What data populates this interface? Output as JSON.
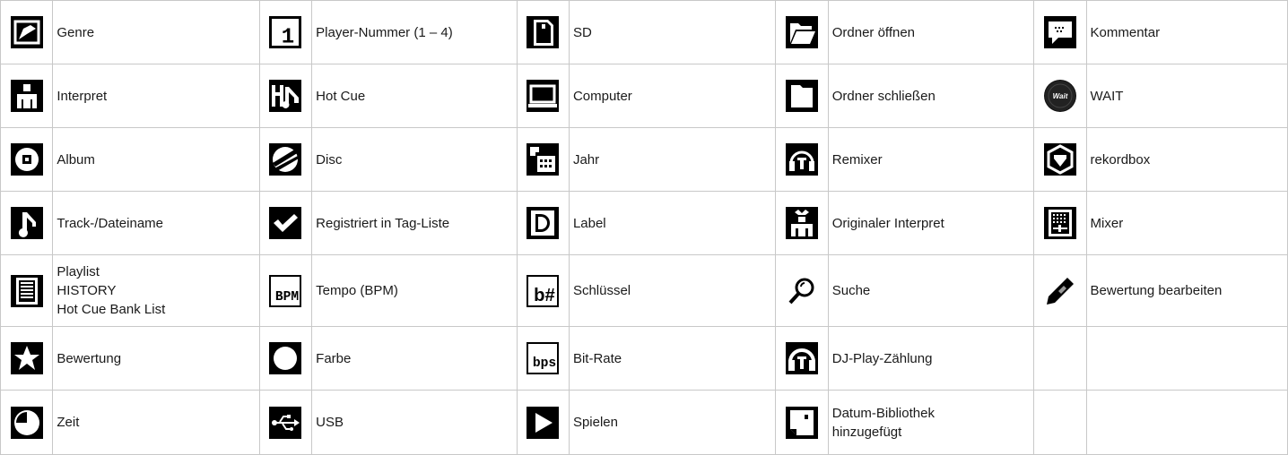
{
  "icon_rows": [
    [
      {
        "icon": "genre-icon",
        "label": "Genre"
      },
      {
        "icon": "player-number-icon",
        "label": "Player-Nummer (1 – 4)"
      },
      {
        "icon": "sd-card-icon",
        "label": "SD"
      },
      {
        "icon": "folder-open-icon",
        "label": "Ordner öffnen"
      },
      {
        "icon": "comment-icon",
        "label": "Kommentar"
      }
    ],
    [
      {
        "icon": "artist-icon",
        "label": "Interpret"
      },
      {
        "icon": "hot-cue-icon",
        "label": "Hot Cue"
      },
      {
        "icon": "computer-icon",
        "label": "Computer"
      },
      {
        "icon": "folder-closed-icon",
        "label": "Ordner schließen"
      },
      {
        "icon": "wait-icon",
        "label": "WAIT"
      }
    ],
    [
      {
        "icon": "album-icon",
        "label": "Album"
      },
      {
        "icon": "disc-icon",
        "label": "Disc"
      },
      {
        "icon": "year-icon",
        "label": "Jahr"
      },
      {
        "icon": "remixer-icon",
        "label": "Remixer"
      },
      {
        "icon": "rekordbox-icon",
        "label": "rekordbox"
      }
    ],
    [
      {
        "icon": "track-icon",
        "label": "Track-/Dateiname"
      },
      {
        "icon": "checkmark-icon",
        "label": "Registriert in Tag-Liste"
      },
      {
        "icon": "label-icon",
        "label": "Label"
      },
      {
        "icon": "original-artist-icon",
        "label": "Originaler Interpret"
      },
      {
        "icon": "mixer-icon",
        "label": "Mixer"
      }
    ],
    [
      {
        "icon": "playlist-icon",
        "label_lines": [
          "Playlist",
          "HISTORY",
          "Hot Cue Bank List"
        ]
      },
      {
        "icon": "bpm-icon",
        "label": "Tempo (BPM)"
      },
      {
        "icon": "key-icon",
        "label": "Schlüssel"
      },
      {
        "icon": "search-icon",
        "label": "Suche"
      },
      {
        "icon": "edit-rating-icon",
        "label": "Bewertung bearbeiten"
      }
    ],
    [
      {
        "icon": "rating-star-icon",
        "label": "Bewertung"
      },
      {
        "icon": "color-icon",
        "label": "Farbe"
      },
      {
        "icon": "bit-rate-icon",
        "label": "Bit-Rate"
      },
      {
        "icon": "dj-play-count-icon",
        "label": "DJ-Play-Zählung"
      },
      {
        "icon": null,
        "label": ""
      }
    ],
    [
      {
        "icon": "time-icon",
        "label": "Zeit"
      },
      {
        "icon": "usb-icon",
        "label": "USB"
      },
      {
        "icon": "play-icon",
        "label": "Spielen"
      },
      {
        "icon": "date-added-icon",
        "label_lines": [
          "Datum-Bibliothek",
          "hinzugefügt"
        ]
      },
      {
        "icon": null,
        "label": ""
      }
    ]
  ],
  "icon_texts": {
    "player_number": "1",
    "bpm": "BPM",
    "bit_rate": "bps",
    "key": "b#",
    "wait": "Wait"
  },
  "colors": {
    "icon_background": "#000000",
    "icon_foreground": "#ffffff",
    "grid_line": "#c8c8c8",
    "text": "#1a1a1a"
  }
}
